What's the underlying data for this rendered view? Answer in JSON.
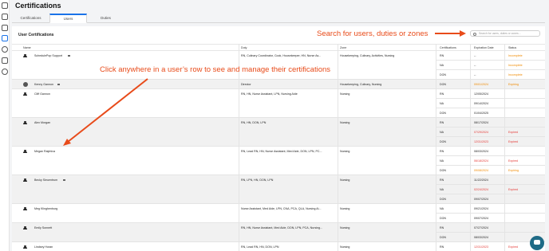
{
  "page_title": "Certifications",
  "tabs": [
    "Certifications",
    "Users",
    "Duties"
  ],
  "panel_title": "User Certifications",
  "search_placeholder": "Search for users, duties or zones...",
  "columns": {
    "name": "Name",
    "duty": "Duty",
    "zone": "Zone",
    "certs": "Certifications",
    "exp": "Expiration Date",
    "status": "Status"
  },
  "annotations": {
    "search": "Search for users, duties or zones",
    "row": "Click anywhere in a user’s row to see and manage their certifications"
  },
  "colors": {
    "accent": "#e84b1a",
    "expired": "#e53935",
    "expiring": "#f08a00"
  },
  "users": [
    {
      "name": "SchedulePop Support",
      "badge": true,
      "photo": false,
      "duty": "RN, Culinary Coordinator, Cook, Housekeeper, HN, Nurse As...",
      "zone": "Housekeeping, Culinary, Activities, Nursing",
      "certs": [
        {
          "c": "RN",
          "e": "--",
          "s": "Incomplete"
        },
        {
          "c": "NA",
          "e": "--",
          "s": "Incomplete"
        },
        {
          "c": "DON",
          "e": "--",
          "s": "Incomplete"
        }
      ]
    },
    {
      "name": "Kenny Gannon",
      "badge": true,
      "photo": true,
      "duty": "Director",
      "zone": "Housekeeping, Culinary, Nursing",
      "certs": [
        {
          "c": "DON",
          "e": "09/01/2024",
          "s": "Expiring"
        }
      ]
    },
    {
      "name": "Cliff Gannon",
      "badge": false,
      "photo": false,
      "duty": "RN, HN, Nurse Assistant, LPN, Nursing Aide",
      "zone": "Nursing",
      "certs": [
        {
          "c": "RN",
          "e": "12/05/2024",
          "s": ""
        },
        {
          "c": "NA",
          "e": "09/14/2024",
          "s": ""
        },
        {
          "c": "DON",
          "e": "01/04/2025",
          "s": ""
        }
      ]
    },
    {
      "name": "Alex Morgan",
      "badge": false,
      "photo": false,
      "duty": "RN, HN, DON, LPN",
      "zone": "Nursing",
      "certs": [
        {
          "c": "RN",
          "e": "08/17/2024",
          "s": ""
        },
        {
          "c": "NA",
          "e": "07/29/2024",
          "s": "Expired"
        },
        {
          "c": "DON",
          "e": "12/31/2023",
          "s": "Expired"
        }
      ]
    },
    {
      "name": "Megan Ralphiva",
      "badge": false,
      "photo": false,
      "duty": "RN, Lead RN, HN, Nurse Assistant, Med Aide, DON, LPN, PC...",
      "zone": "Nursing",
      "certs": [
        {
          "c": "RN",
          "e": "08/03/2024",
          "s": ""
        },
        {
          "c": "NA",
          "e": "06/18/2024",
          "s": "Expired"
        },
        {
          "c": "DON",
          "e": "09/08/2024",
          "s": "Expiring"
        }
      ]
    },
    {
      "name": "Becky Sieuentrum",
      "badge": true,
      "photo": false,
      "duty": "RN, LPN, HN, DON, LPN",
      "zone": "Nursing",
      "certs": [
        {
          "c": "RN",
          "e": "11/22/2024",
          "s": ""
        },
        {
          "c": "NA",
          "e": "02/24/2024",
          "s": "Expired"
        },
        {
          "c": "DON",
          "e": "09/07/2024",
          "s": ""
        }
      ]
    },
    {
      "name": "Meg Klinghenburg",
      "badge": false,
      "photo": false,
      "duty": "Nurse Assistant, Med Aide, LPN, CNA, PCA, QLA, Nursing Ai...",
      "zone": "Nursing",
      "certs": [
        {
          "c": "NA",
          "e": "09/21/2024",
          "s": ""
        },
        {
          "c": "DON",
          "e": "09/07/2024",
          "s": ""
        }
      ]
    },
    {
      "name": "Emily Sonnett",
      "badge": false,
      "photo": false,
      "duty": "RN, HN, Nurse Assistant, Med Aide, DON, LPN, PCA, Nursing...",
      "zone": "Nursing",
      "certs": [
        {
          "c": "RN",
          "e": "07/27/2024",
          "s": ""
        },
        {
          "c": "DON",
          "e": "08/03/2024",
          "s": ""
        }
      ]
    },
    {
      "name": "Lindsey Horan",
      "badge": false,
      "photo": false,
      "duty": "RN, Lead RN, HN, DON, LPN",
      "zone": "Nursing",
      "certs": [
        {
          "c": "RN",
          "e": "12/31/2023",
          "s": "Expired"
        }
      ]
    }
  ]
}
